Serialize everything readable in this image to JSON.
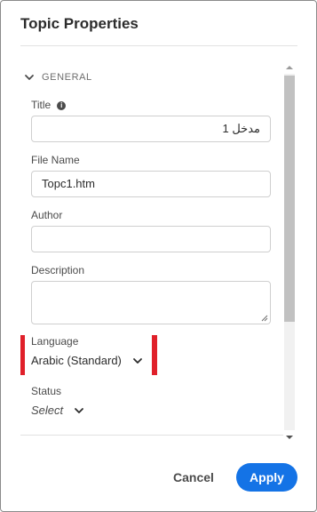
{
  "dialog": {
    "title": "Topic Properties"
  },
  "section": {
    "label": "GENERAL",
    "icon": "chevron-down-icon",
    "expanded": true
  },
  "fields": {
    "title": {
      "label": "Title",
      "value": "مدخل 1",
      "info_icon": "info-icon"
    },
    "file_name": {
      "label": "File Name",
      "value": "Topc1.htm"
    },
    "author": {
      "label": "Author",
      "value": ""
    },
    "description": {
      "label": "Description",
      "value": ""
    },
    "language": {
      "label": "Language",
      "value": "Arabic (Standard)",
      "highlight_color": "#e0202a"
    },
    "status": {
      "label": "Status",
      "value": "Select"
    }
  },
  "buttons": {
    "cancel": "Cancel",
    "apply": "Apply"
  },
  "colors": {
    "accent": "#1473e6",
    "highlight": "#e0202a"
  }
}
